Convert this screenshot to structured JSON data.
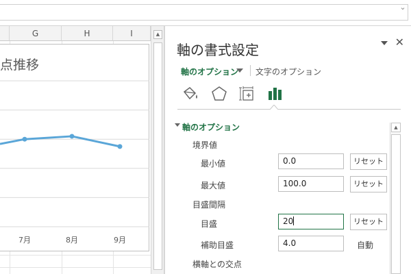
{
  "columns": [
    "G",
    "H",
    "I"
  ],
  "chart": {
    "title_fragment": "点推移"
  },
  "chart_data": {
    "type": "line",
    "categories": [
      "7月",
      "8月",
      "9月"
    ],
    "series": [
      {
        "values": [
          60,
          62,
          55
        ]
      }
    ],
    "ylim": [
      0,
      100
    ],
    "color": "#5aa6d8"
  },
  "panel": {
    "title": "軸の書式設定",
    "tab_axis": "軸のオプション",
    "tab_text": "文字のオプション",
    "icons": [
      "fill-bucket-icon",
      "pentagon-icon",
      "size-properties-icon",
      "bar-chart-icon"
    ],
    "accent": "#217346",
    "section": "軸のオプション",
    "bounds_group": "境界値",
    "min_label": "最小値",
    "min_value": "0.0",
    "max_label": "最大値",
    "max_value": "100.0",
    "units_group": "目盛間隔",
    "major_label": "目盛",
    "major_value": "20",
    "minor_label": "補助目盛",
    "minor_value": "4.0",
    "reset_label": "リセット",
    "auto_label": "自動",
    "crosses_group": "横軸との交点"
  }
}
